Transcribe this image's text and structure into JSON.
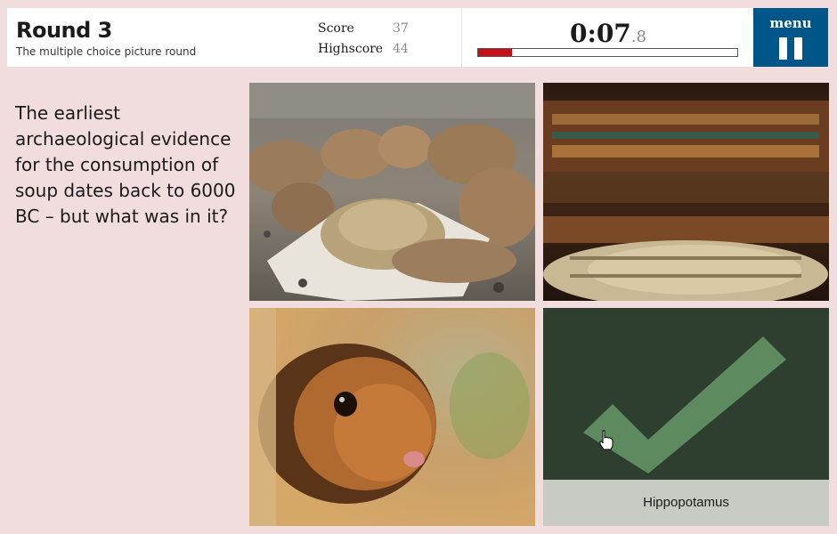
{
  "header": {
    "round_title": "Round 3",
    "round_subtitle": "The multiple choice picture round",
    "score_label": "Score",
    "score_value": "37",
    "highscore_label": "Highscore",
    "highscore_value": "44",
    "timer_main": "0:07",
    "timer_tenths": ".8",
    "timer_progress_fraction": 0.13,
    "menu_label": "menu"
  },
  "question": {
    "text": "The earliest archaeological evidence for the consumption of soup dates back to 6000 BC – but what was in it?"
  },
  "answers": [
    {
      "image": "camels",
      "label": ""
    },
    {
      "image": "egyptian-mummy-sarcophagus",
      "label": ""
    },
    {
      "image": "hamster",
      "label": ""
    },
    {
      "image": "correct-checkmark",
      "label": "Hippopotamus",
      "state": "correct"
    }
  ],
  "colors": {
    "background": "#f1dcde",
    "menu_button": "#005689",
    "progress_fill": "#c8101a",
    "correct_tile": "#2e3f2f",
    "checkmark": "#5d8a5f"
  },
  "icons": [
    "pause-icon",
    "check-icon",
    "hand-cursor-icon"
  ]
}
